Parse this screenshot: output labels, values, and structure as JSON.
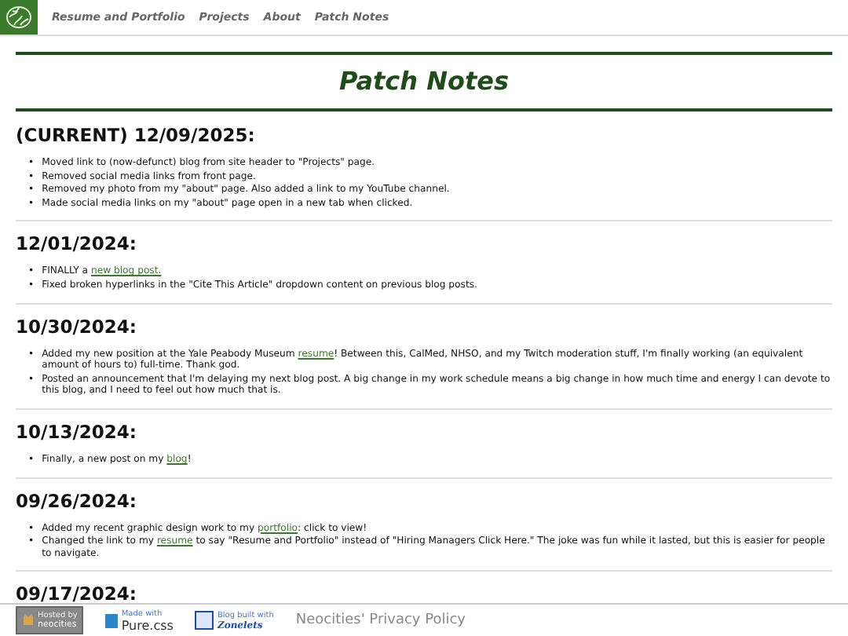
{
  "nav": {
    "items": [
      {
        "label": "Resume and Portfolio"
      },
      {
        "label": "Projects"
      },
      {
        "label": "About"
      },
      {
        "label": "Patch Notes"
      }
    ]
  },
  "title": "Patch Notes",
  "sections": [
    {
      "heading": "(CURRENT) 12/09/2025:",
      "items": [
        {
          "bullet": "•",
          "parts": [
            {
              "kind": "text",
              "t": "Moved link to (now-defunct) blog from site header to \"Projects\" page."
            }
          ]
        },
        {
          "bullet": "•",
          "parts": [
            {
              "kind": "text",
              "t": "Removed social media links from front page."
            }
          ]
        },
        {
          "bullet": "•",
          "parts": [
            {
              "kind": "text",
              "t": "Removed my photo from my \"about\" page. Also added a link to my YouTube channel."
            }
          ]
        },
        {
          "bullet": "•",
          "parts": [
            {
              "kind": "text",
              "t": "Made social media links on my \"about\" page open in a new tab when clicked."
            }
          ]
        }
      ]
    },
    {
      "heading": "12/01/2024:",
      "items": [
        {
          "bullet": "•",
          "parts": [
            {
              "kind": "text",
              "t": "FINALLY a "
            },
            {
              "kind": "link",
              "t": "new blog post."
            }
          ]
        },
        {
          "bullet": "•",
          "parts": [
            {
              "kind": "text",
              "t": "Fixed broken hyperlinks in the \"Cite This Article\" dropdown content on previous blog posts."
            }
          ]
        }
      ]
    },
    {
      "heading": "10/30/2024:",
      "items": [
        {
          "bullet": "•",
          "parts": [
            {
              "kind": "text",
              "t": "Added my new position at the Yale Peabody Museum "
            },
            {
              "kind": "link",
              "t": "resume"
            },
            {
              "kind": "text",
              "t": "! Between this, CalMed, NHSO, and my Twitch moderation stuff, I'm finally working (an equivalent amount of hours to) full-time. Thank god."
            }
          ]
        },
        {
          "bullet": "•",
          "parts": [
            {
              "kind": "text",
              "t": "Posted an announcement that I'm delaying my next blog post. A big change in my work schedule means a big change in how much time and energy I can devote to this blog, and I need to feel out how much that is."
            }
          ]
        }
      ]
    },
    {
      "heading": "10/13/2024:",
      "items": [
        {
          "bullet": "•",
          "parts": [
            {
              "kind": "text",
              "t": "Finally, a new post on my "
            },
            {
              "kind": "link",
              "t": "blog"
            },
            {
              "kind": "text",
              "t": "!"
            }
          ]
        }
      ]
    },
    {
      "heading": "09/26/2024:",
      "items": [
        {
          "bullet": "•",
          "parts": [
            {
              "kind": "text",
              "t": "Added my recent graphic design work to my "
            },
            {
              "kind": "link",
              "t": "portfolio"
            },
            {
              "kind": "text",
              "t": ": click to view!"
            }
          ]
        },
        {
          "bullet": "•",
          "parts": [
            {
              "kind": "text",
              "t": "Changed the link to my "
            },
            {
              "kind": "link",
              "t": "resume"
            },
            {
              "kind": "text",
              "t": " to say \"Resume and Portfolio\" instead of \"Hiring Managers Click Here.\" The joke was fun while it lasted, but this is easier for people to navigate."
            }
          ]
        }
      ]
    },
    {
      "heading": "09/17/2024:"
    }
  ],
  "footer": {
    "badges": [
      {
        "kind": "neocities",
        "caption": "Hosted by",
        "label": "neocities"
      },
      {
        "kind": "pure",
        "caption": "Made with",
        "label": "Pure.css"
      },
      {
        "kind": "zonelets",
        "caption": "Blog built with",
        "label": "Zonelets"
      }
    ],
    "link": "Neocities' Privacy Policy"
  }
}
